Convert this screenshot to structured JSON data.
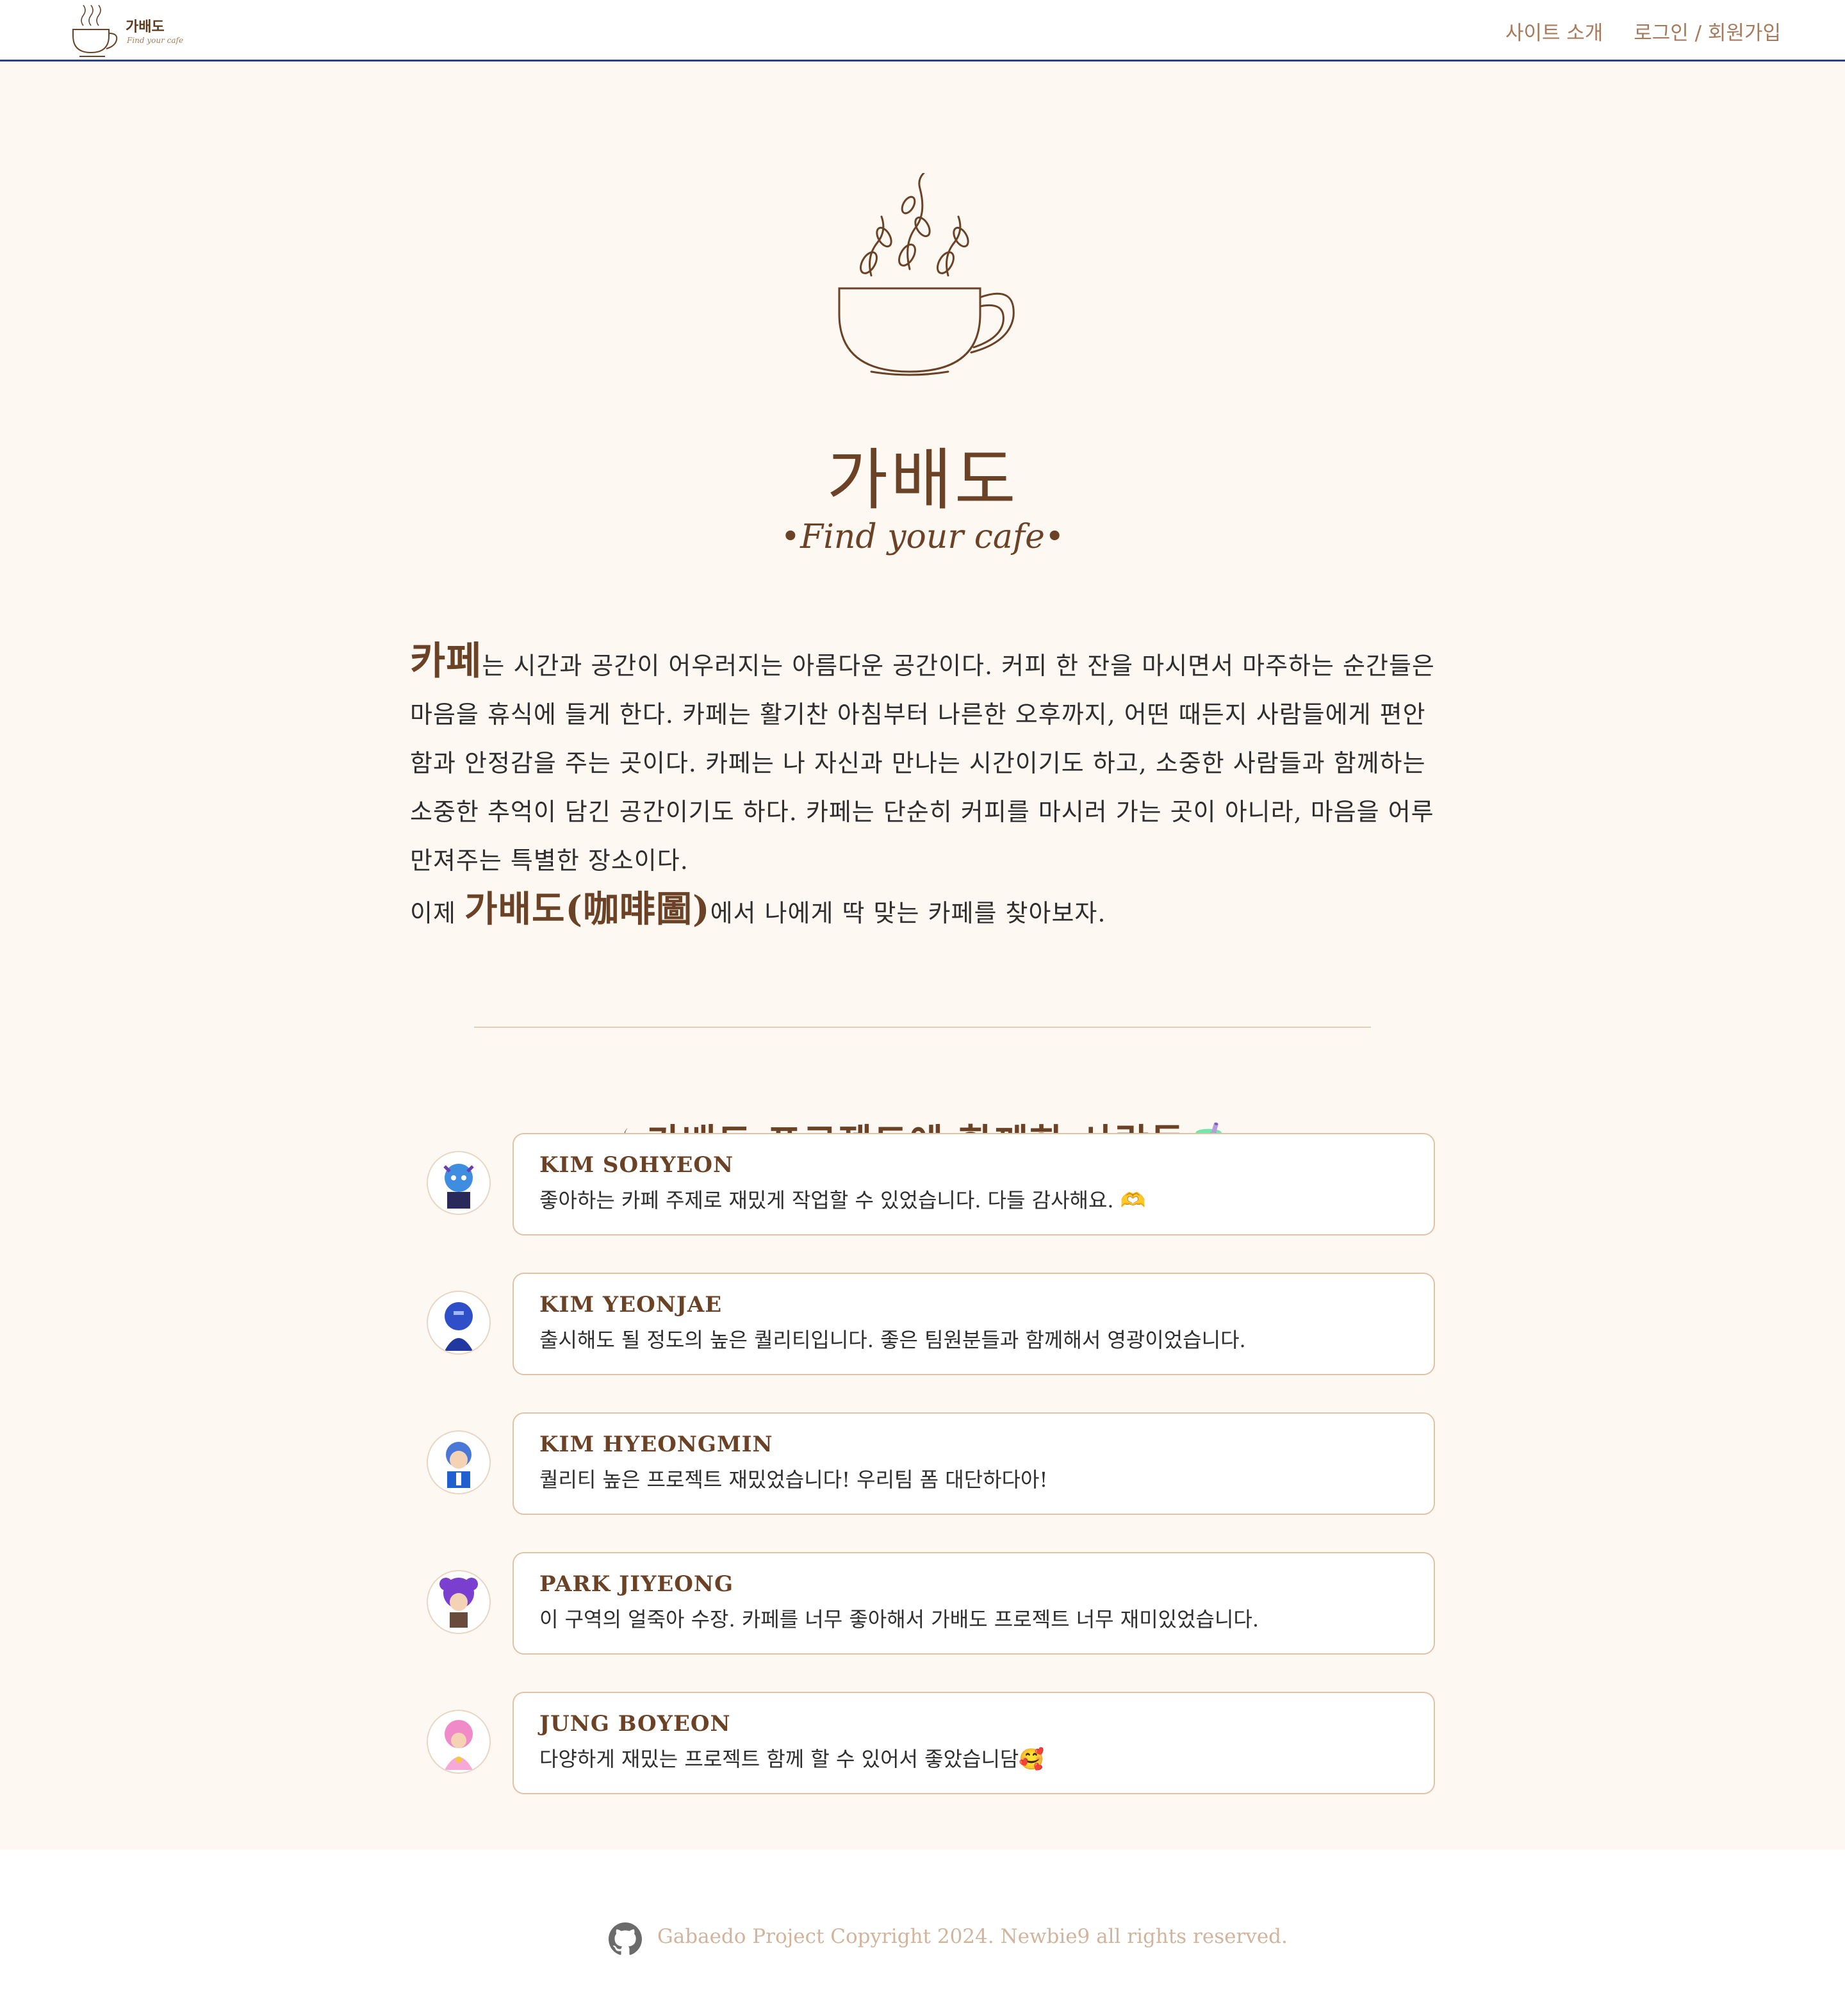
{
  "header": {
    "brand_name": "가배도",
    "brand_tagline": "Find your cafe",
    "nav": [
      "사이트 소개",
      "로그인 / 회원가입"
    ]
  },
  "hero": {
    "title": "가배도",
    "tagline": "•Find your cafe•"
  },
  "intro": {
    "lead_word": "카페",
    "paragraph": "는 시간과 공간이 어우러지는 아름다운 공간이다. 커피 한 잔을 마시면서 마주하는 순간들은 마음을 휴식에 들게 한다. 카페는 활기찬 아침부터 나른한 오후까지, 어떤 때든지 사람들에게 편안함과 안정감을 주는 곳이다. 카페는 나 자신과 만나는 시간이기도 하고, 소중한 사람들과 함께하는 소중한 추억이 담긴 공간이기도 하다. 카페는 단순히 커피를 마시러 가는 곳이 아니라, 마음을 어루만져주는 특별한 장소이다.",
    "closing_prefix": "이제 ",
    "closing_highlight": "가배도(咖啡圖)",
    "closing_suffix": "에서 나에게 딱 맞는 카페를 찾아보자."
  },
  "team": {
    "title": "☕가배도 프로젝트에 함께한 사람들🧋",
    "members": [
      {
        "name": "KIM SOHYEON",
        "message": "좋아하는 카페 주제로 재밌게 작업할 수 있었습니다. 다들 감사해요. 🫶"
      },
      {
        "name": "KIM YEONJAE",
        "message": "출시해도 될 정도의 높은 퀄리티입니다. 좋은 팀원분들과 함께해서 영광이었습니다."
      },
      {
        "name": "KIM HYEONGMIN",
        "message": "퀄리티 높은 프로젝트 재밌었습니다! 우리팀 폼 대단하다아!"
      },
      {
        "name": "PARK JIYEONG",
        "message": "이 구역의 얼죽아 수장. 카페를 너무 좋아해서 가배도 프로젝트 너무 재미있었습니다."
      },
      {
        "name": "JUNG BOYEON",
        "message": "다양하게 재밌는 프로젝트 함께 할 수 있어서 좋았습니담🥰"
      }
    ]
  },
  "footer": {
    "copyright": "Gabaedo Project Copyright 2024.  Newbie9 all rights reserved.",
    "icon": "github-icon"
  },
  "colors": {
    "brand_brown": "#6b4226",
    "background": "#fdf8f2",
    "header_border": "#2a3f8f",
    "nav_text": "#a77a5c",
    "card_border": "#dfc3a4",
    "footer_text": "#d2b49c"
  }
}
